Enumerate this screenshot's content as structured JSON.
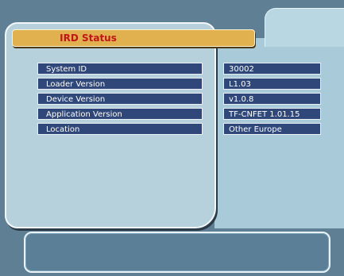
{
  "header": {
    "title": "IRD Status"
  },
  "status_rows": [
    {
      "label": "System ID",
      "value": "30002"
    },
    {
      "label": "Loader Version",
      "value": "L1.03"
    },
    {
      "label": "Device Version",
      "value": "v1.0.8"
    },
    {
      "label": "Application Version",
      "value": "TF-CNFET 1.01.15"
    },
    {
      "label": "Location",
      "value": "Other Europe"
    }
  ],
  "message_box": {
    "text": ""
  },
  "colors": {
    "background": "#5f7f95",
    "card": "#b7d1dc",
    "title_bar": "#e2b14f",
    "title_text": "#c01616",
    "row": "#2f4879"
  }
}
